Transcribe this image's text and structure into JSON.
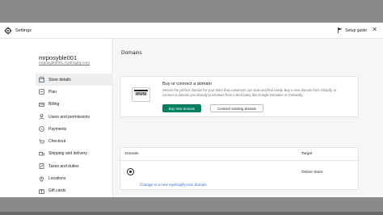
{
  "header": {
    "title": "Settings",
    "setup_guide": "Setup guide",
    "close": "✕"
  },
  "sidebar": {
    "store_name": "mrposyble001",
    "store_domain": "mrposyble001.myshopify.com",
    "items": [
      {
        "label": "Store details",
        "icon": "store-icon",
        "active": true
      },
      {
        "label": "Plan",
        "icon": "plan-icon"
      },
      {
        "label": "Billing",
        "icon": "billing-icon"
      },
      {
        "label": "Users and permissions",
        "icon": "users-icon"
      },
      {
        "label": "Payments",
        "icon": "payments-icon"
      },
      {
        "label": "Checkout",
        "icon": "checkout-icon"
      },
      {
        "label": "Shipping and delivery",
        "icon": "shipping-icon"
      },
      {
        "label": "Taxes and duties",
        "icon": "taxes-icon"
      },
      {
        "label": "Locations",
        "icon": "location-icon"
      },
      {
        "label": "Gift cards",
        "icon": "gift-card-icon"
      }
    ]
  },
  "main": {
    "page_title": "Domains",
    "buy_card": {
      "icon_text": "WWW",
      "title": "Buy or connect a domain",
      "description": "Secure the perfect domain for your store that customers can trust and find easily. Buy a new domain from Shopify, or connect a domain you already purchased from a third-party like Google Domains or GoDaddy.",
      "buy_button": "Buy new domain",
      "connect_button": "Connect existing domain"
    },
    "domains_table": {
      "col_domain": "Domain",
      "col_target": "Target",
      "target_value": "Online Store",
      "change_link": "Change to a new myshopify.com domain"
    }
  },
  "colors": {
    "primary": "#008060",
    "link": "#2c6ecb",
    "text": "#202223",
    "muted": "#6d7175"
  }
}
